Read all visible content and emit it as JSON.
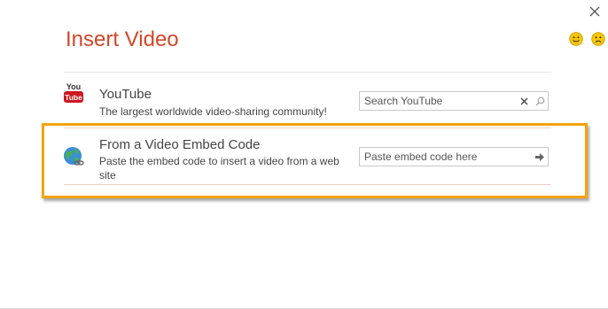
{
  "dialog": {
    "title": "Insert Video"
  },
  "sources": {
    "youtube": {
      "icon": "youtube-icon",
      "logo_top": "You",
      "logo_bottom": "Tube",
      "title": "YouTube",
      "description": "The largest worldwide video-sharing community!",
      "search_placeholder": "Search YouTube"
    },
    "embed": {
      "icon": "globe-link-icon",
      "title": "From a Video Embed Code",
      "description": "Paste the embed code to insert a video from a web site",
      "input_placeholder": "Paste embed code here"
    }
  },
  "colors": {
    "title": "#d24726",
    "highlight": "#f5a20a",
    "youtube_red": "#cc181e",
    "face_yellow": "#f7c600"
  }
}
